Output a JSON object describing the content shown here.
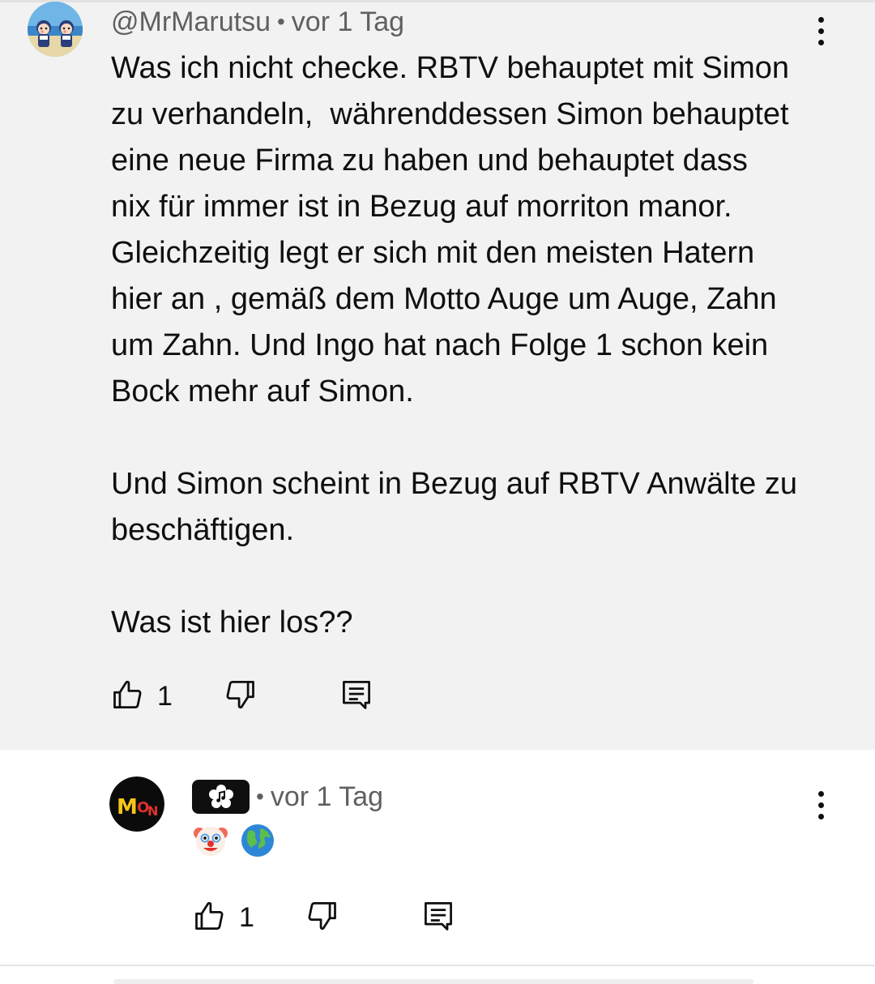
{
  "comments": [
    {
      "author": "@MrMarutsu",
      "time": "vor 1 Tag",
      "text": "Was ich nicht checke. RBTV behauptet mit Simon\nzu verhandeln,  währenddessen Simon behauptet\neine neue Firma zu haben und behauptet dass\nnix für immer ist in Bezug auf morriton manor.\nGleichzeitig legt er sich mit den meisten Hatern\nhier an , gemäß dem Motto Auge um Auge, Zahn\num Zahn. Und Ingo hat nach Folge 1 schon kein\nBock mehr auf Simon.\n\nUnd Simon scheint in Bezug auf RBTV Anwälte zu\nbeschäftigen.\n\nWas ist hier los??",
      "likes": "1"
    }
  ],
  "reply": {
    "time": "vor 1 Tag",
    "emojis": [
      "🤡",
      "🌎"
    ],
    "likes": "1",
    "avatar_text": "MON"
  },
  "icons": {
    "like": "thumbs-up-icon",
    "dislike": "thumbs-down-icon",
    "reply": "comment-reply-icon",
    "more": "more-vertical-icon",
    "badge": "music-flower-badge-icon"
  },
  "colors": {
    "highlight_bg": "#f2f2f2",
    "meta_text": "#606060",
    "text": "#0f0f0f"
  }
}
